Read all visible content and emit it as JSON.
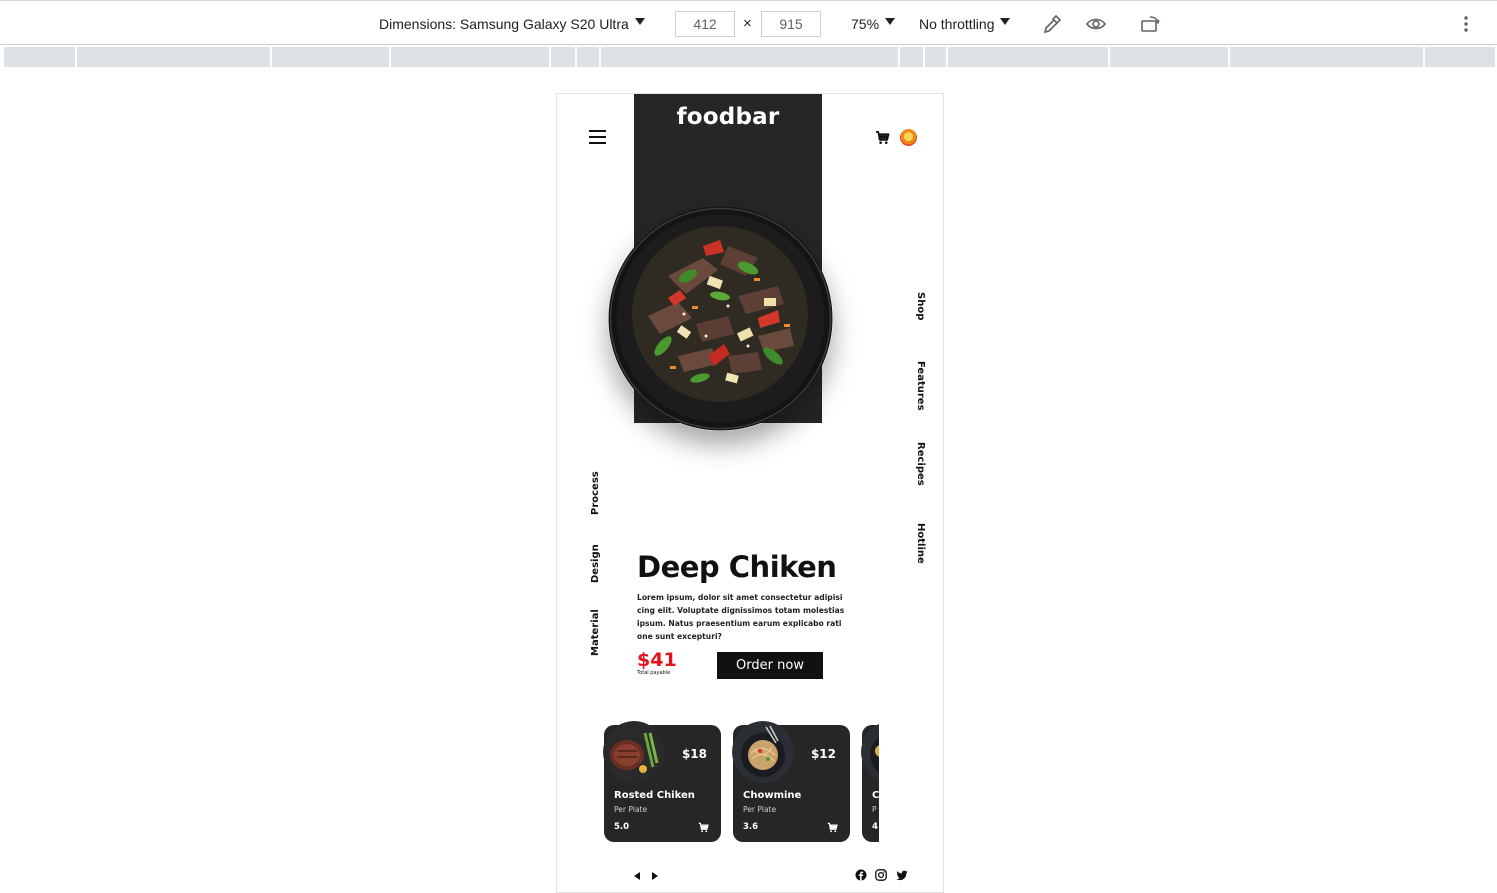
{
  "devtools": {
    "dimensions_label": "Dimensions: Samsung Galaxy S20 Ultra",
    "width_value": "412",
    "times_sign": "×",
    "height_value": "915",
    "zoom_label": "75%",
    "throttle_label": "No throttling",
    "icons": [
      "eyedropper-icon",
      "eye-icon",
      "rotate-device-icon",
      "more-options-icon"
    ]
  },
  "page": {
    "logo": "foodbar",
    "nav_right": [
      "Shop",
      "Features",
      "Recipes",
      "Hotline"
    ],
    "nav_left": [
      "Process",
      "Design",
      "Material"
    ],
    "hero": {
      "title": "Deep Chiken",
      "description": "Lorem ipsum, dolor sit amet consectetur adipisicing elit. Voluptate dignissimos totam molestias ipsum. Natus praesentium earum explicabo ratione sunt excepturi?",
      "price": "$41",
      "price_note": "Total payable",
      "order_button": "Order now"
    },
    "cards": [
      {
        "name": "Rosted Chiken",
        "sub": "Per Plate",
        "price": "$18",
        "rating": "5.0"
      },
      {
        "name": "Chowmine",
        "sub": "Per Plate",
        "price": "$12",
        "rating": "3.6"
      },
      {
        "name": "C",
        "sub": "P",
        "price": "",
        "rating": "4"
      }
    ],
    "colors": {
      "accent_red": "#e3121c",
      "dark_panel": "#262626"
    },
    "social_icons": [
      "facebook-icon",
      "instagram-icon",
      "twitter-icon"
    ]
  }
}
